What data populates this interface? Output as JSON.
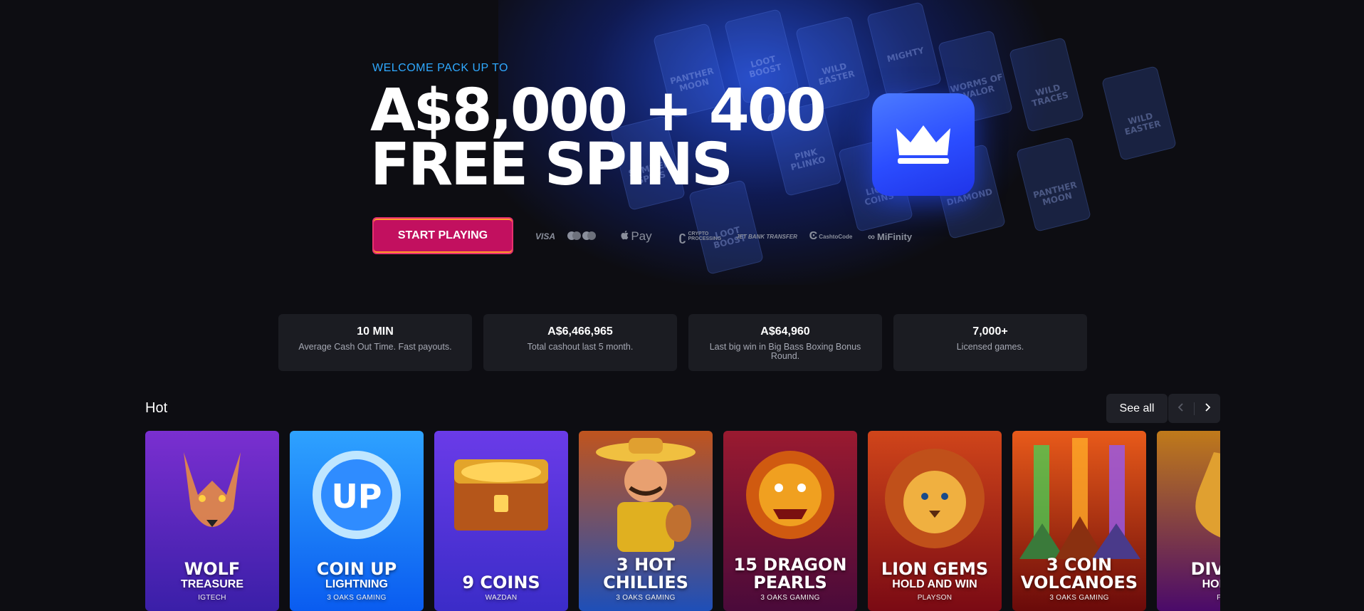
{
  "hero": {
    "eyebrow": "WELCOME PACK UP TO",
    "title_line1": "A$8,000 + 400",
    "title_line2": "FREE SPINS",
    "cta": "START PLAYING",
    "background_tiles": [
      "PANTHER MOON",
      "LOOT BOOST",
      "WILD EASTER",
      "MIGHTY",
      "WORMS OF VALOR",
      "WILD TRACES",
      "SUMMER SPINS",
      "PINK PLINKO",
      "LION COINS",
      "DIAMOND"
    ],
    "payments": [
      "VISA",
      "Mastercard",
      "Pay",
      "CRYPTO PROCESSING",
      "JET BANK TRANSFER",
      "CashtoCode",
      "MiFinity"
    ],
    "accent_color": "#2fa9ff",
    "cta_color": "#c2105f"
  },
  "stats": [
    {
      "value": "10 MIN",
      "label": "Average Cash Out Time. Fast payouts."
    },
    {
      "value": "A$6,466,965",
      "label": "Total cashout last 5 month."
    },
    {
      "value": "A$64,960",
      "label": "Last big win in Big Bass Boxing Bonus Round."
    },
    {
      "value": "7,000+",
      "label": "Licensed games."
    }
  ],
  "hot": {
    "title": "Hot",
    "see_all": "See all",
    "games": [
      {
        "title": "WOLF",
        "subtitle": "TREASURE",
        "provider": "IGTECH",
        "bg1": "#3a1fa8",
        "bg2": "#7a2fd0",
        "icon": "wolf-icon"
      },
      {
        "title": "COIN UP",
        "subtitle": "LIGHTNING",
        "provider": "3 OAKS GAMING",
        "bg1": "#0a5cf0",
        "bg2": "#2ea2ff",
        "icon": "coin-icon"
      },
      {
        "title": "9 COINS",
        "subtitle": "",
        "provider": "WAZDAN",
        "bg1": "#3b2cc8",
        "bg2": "#6a3be8",
        "icon": "treasure-chest-icon"
      },
      {
        "title": "3 HOT",
        "subtitle": "CHILLIES",
        "provider": "3 OAKS GAMING",
        "bg1": "#1e4fb8",
        "bg2": "#c0541e",
        "icon": "mariachi-icon"
      },
      {
        "title": "15 DRAGON",
        "subtitle": "PEARLS",
        "provider": "3 OAKS GAMING",
        "bg1": "#4a0a3a",
        "bg2": "#9a1a30",
        "icon": "dragon-icon"
      },
      {
        "title": "LION GEMS",
        "subtitle": "HOLD AND WIN",
        "provider": "PLAYSON",
        "bg1": "#7a0a14",
        "bg2": "#d0451a",
        "icon": "lion-icon"
      },
      {
        "title": "3 COIN",
        "subtitle": "VOLCANOES",
        "provider": "3 OAKS GAMING",
        "bg1": "#6a0a0a",
        "bg2": "#e85a1a",
        "icon": "volcano-icon"
      },
      {
        "title": "DIVINE",
        "subtitle": "HOLD A",
        "provider": "PLA",
        "bg1": "#4a0a6a",
        "bg2": "#c07a1a",
        "icon": "golden-dragon-icon"
      }
    ]
  }
}
